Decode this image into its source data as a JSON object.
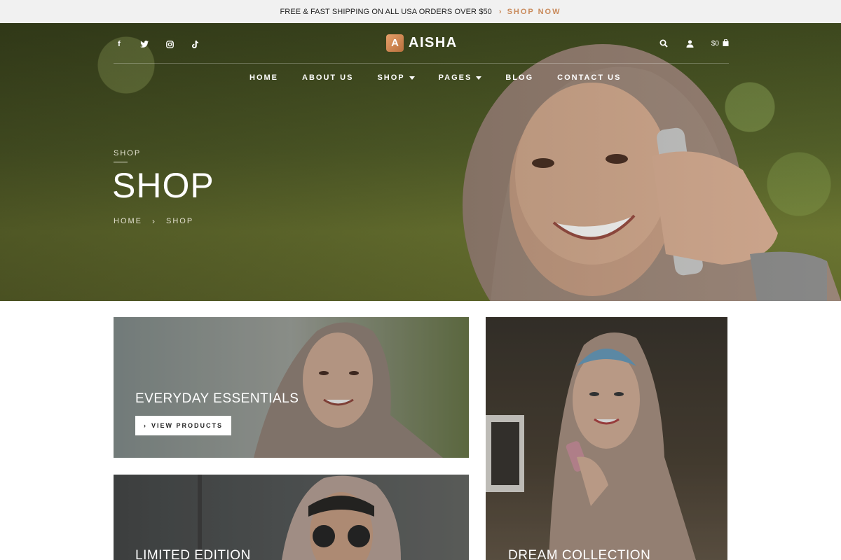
{
  "topbar": {
    "message": "FREE & FAST SHIPPING ON ALL USA ORDERS OVER $50",
    "cta_label": "SHOP NOW",
    "cta_arrow": "›",
    "cta_color": "#c98a5b"
  },
  "header": {
    "social_icons": [
      "facebook-icon",
      "twitter-icon",
      "instagram-icon",
      "tiktok-icon"
    ],
    "logo_letter": "A",
    "logo_name": "AISHA",
    "cart_total": "$0"
  },
  "nav": {
    "items": [
      {
        "label": "HOME"
      },
      {
        "label": "ABOUT US"
      },
      {
        "label": "SHOP"
      },
      {
        "label": "PAGES"
      },
      {
        "label": "BLOG"
      },
      {
        "label": "CONTACT US"
      }
    ]
  },
  "hero": {
    "eyebrow": "SHOP",
    "title": "SHOP",
    "breadcrumb": {
      "home": "HOME",
      "current": "SHOP",
      "separator": "›"
    }
  },
  "cards": [
    {
      "title": "EVERYDAY ESSENTIALS",
      "button_label": "VIEW PRODUCTS",
      "button_arrow": "›"
    },
    {
      "title": "DREAM COLLECTION"
    },
    {
      "title": "LIMITED EDITION"
    }
  ],
  "colors": {
    "accent": "#c98a5b",
    "topbar_bg": "#f1f1f1"
  }
}
